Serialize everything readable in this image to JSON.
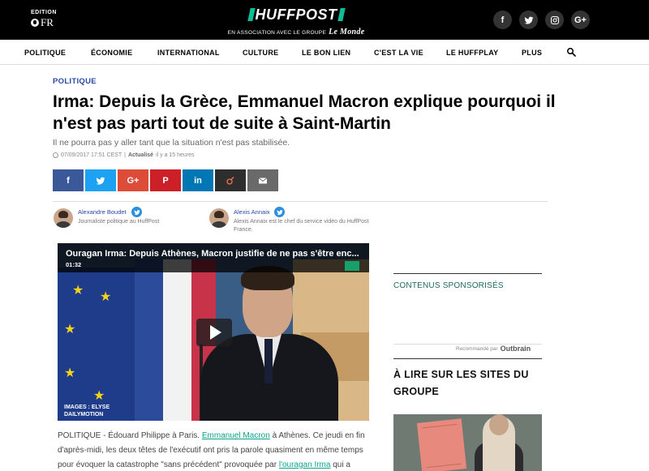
{
  "header": {
    "edition_label": "EDITION",
    "edition_value": "FR",
    "logo_text": "HUFFPOST",
    "tagline": "EN ASSOCIATION AVEC LE GROUPE",
    "tagline_partner": "Le Monde",
    "social": [
      {
        "icon": "facebook-icon",
        "glyph": "f"
      },
      {
        "icon": "twitter-icon",
        "glyph": ""
      },
      {
        "icon": "instagram-icon",
        "glyph": ""
      },
      {
        "icon": "google-plus-icon",
        "glyph": "G+"
      }
    ]
  },
  "nav": {
    "items": [
      "POLITIQUE",
      "ÉCONOMIE",
      "INTERNATIONAL",
      "CULTURE",
      "LE BON LIEN",
      "C'EST LA VIE",
      "LE HUFFPLAY",
      "PLUS"
    ],
    "search_icon": "search-icon"
  },
  "article": {
    "kicker": "POLITIQUE",
    "headline": "Irma: Depuis la Grèce, Emmanuel Macron explique pourquoi il n'est pas parti tout de suite à Saint-Martin",
    "deck": "Il ne pourra pas y aller tant que la situation n'est pas stabilisée.",
    "date": "07/09/2017 17:51 CEST",
    "sep": "|",
    "updated_label": "Actualisé",
    "updated_ago": "il y a 15 heures",
    "share": [
      {
        "name": "facebook",
        "color": "#3b5998",
        "glyph": "f"
      },
      {
        "name": "twitter",
        "color": "#1da1f2",
        "glyph": ""
      },
      {
        "name": "google-plus",
        "color": "#dd4b39",
        "glyph": "G+"
      },
      {
        "name": "pinterest",
        "color": "#cb2027",
        "glyph": "P"
      },
      {
        "name": "linkedin",
        "color": "#0077b5",
        "glyph": "in"
      },
      {
        "name": "viadeo",
        "color": "#2e2e2e",
        "glyph": ""
      },
      {
        "name": "email",
        "color": "#6a6a6a",
        "glyph": ""
      }
    ],
    "authors": [
      {
        "name": "Alexandre Boudet",
        "bio": "Journaliste politique au HuffPost"
      },
      {
        "name": "Alexis Annaix",
        "bio": "Alexis Annaix est le chef du service vidéo du HuffPost France."
      }
    ],
    "video": {
      "title": "Ouragan Irma: Depuis Athènes, Macron justifie de ne pas s'être enc...",
      "duration": "01:32",
      "credit_line1": "IMAGES : ELYSE",
      "credit_line2": "DAILYMOTION"
    },
    "body": {
      "p1_a": "POLITIQUE - Édouard Philippe à Paris.",
      "link1": "Emmanuel Macron",
      "p1_b": "à Athènes. Ce jeudi en fin d'après-midi, les deux têtes de l'exécutif ont pris la parole quasiment en même temps pour évoquer la catastrophe \"sans précédent\" provoquée par",
      "link2": "l'ouragan Irma",
      "p1_c": "qui a frappé"
    }
  },
  "sidebar": {
    "sponsored_title": "CONTENUS SPONSORISÉS",
    "recommended_by": "Recommandé par",
    "outbrain": "Outbrain",
    "group_title": "À LIRE SUR LES SITES DU GROUPE"
  }
}
